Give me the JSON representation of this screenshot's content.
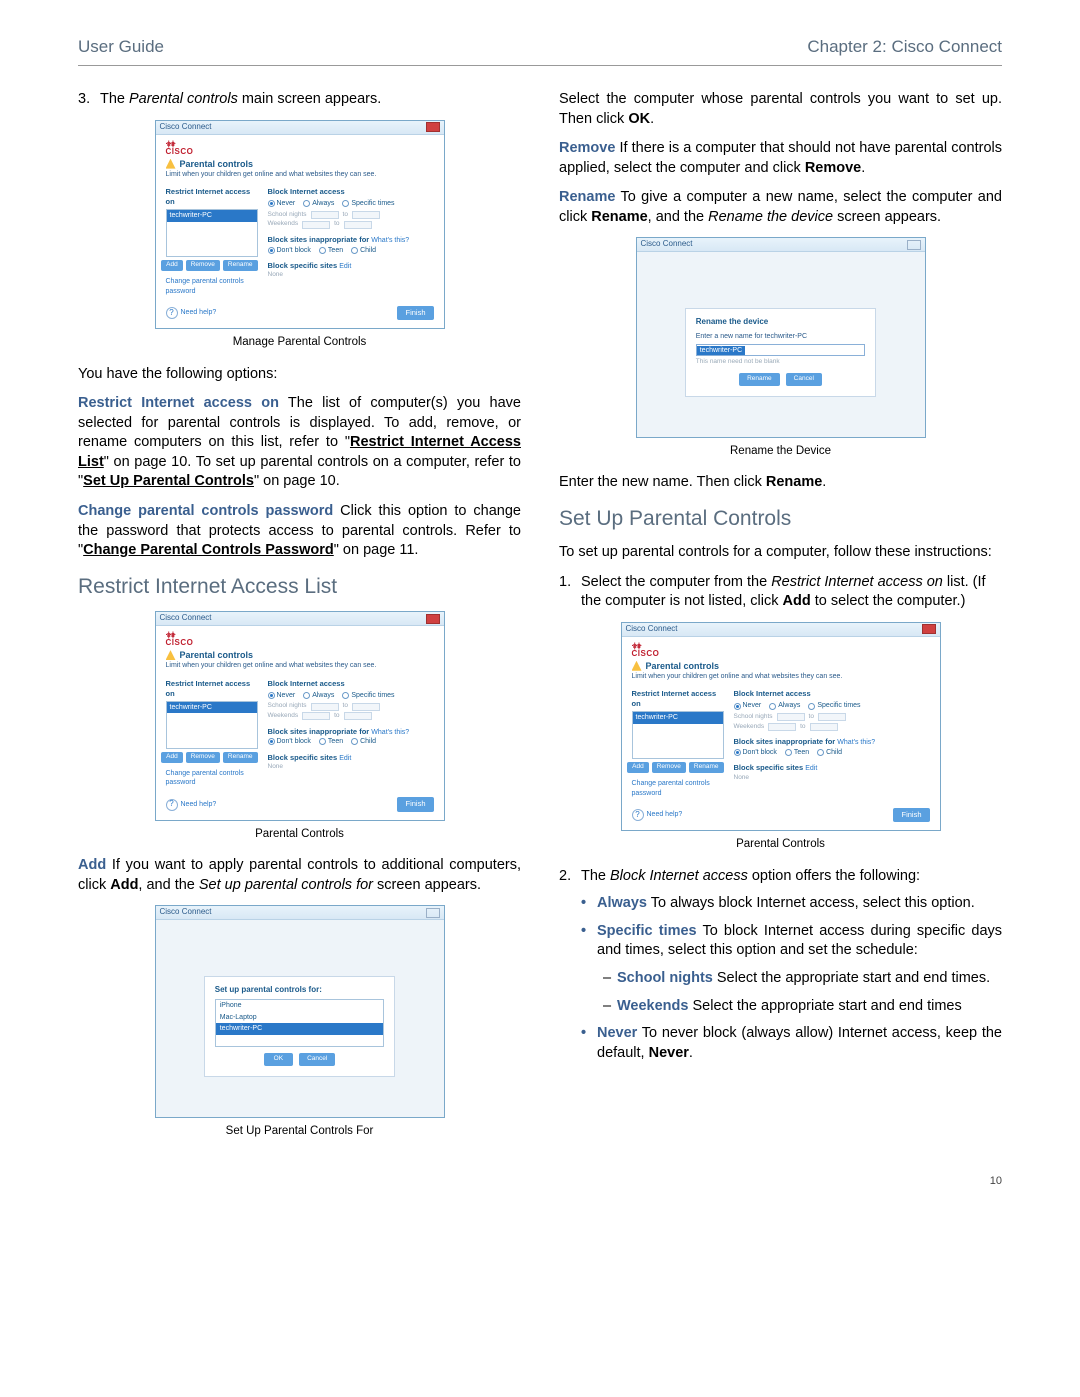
{
  "header": {
    "left": "User Guide",
    "right": "Chapter 2: Cisco Connect"
  },
  "page_number": "10",
  "left_col": {
    "step3": {
      "num": "3.",
      "pre": "The ",
      "ital": "Parental controls",
      "post": " main screen appears."
    },
    "fig1_caption": "Manage Parental Controls",
    "options_intro": "You have the following options:",
    "p_restrict": {
      "lead": "Restrict Internet access on",
      "t1": " The list of computer(s) you have selected for parental controls is displayed. To add, remove, or rename computers on this list, refer to \"",
      "link1": "Restrict Internet Access List",
      "t2": "\" on page 10. To set up parental controls on a computer, refer to \"",
      "link2": "Set Up Parental Controls",
      "t3": "\" on page 10."
    },
    "p_change": {
      "lead": "Change parental controls password",
      "t1": " Click this option to change the password that protects access to parental controls. Refer to \"",
      "link1": "Change Parental Controls Password",
      "t2": "\" on page 11."
    },
    "h_restrict": "Restrict Internet Access List",
    "fig2_caption": "Parental Controls",
    "p_add": {
      "lead": "Add",
      "t1": "  If you want to apply parental controls to additional computers, click ",
      "b1": "Add",
      "t2": ", and the ",
      "ital": "Set up parental controls for",
      "t3": " screen appears."
    },
    "fig3_caption": "Set Up Parental Controls For"
  },
  "right_col": {
    "p_select": {
      "t1": "Select the computer whose parental controls you want to set up. Then click ",
      "b1": "OK",
      "t2": "."
    },
    "p_remove": {
      "lead": "Remove",
      "t1": " If there is a computer that should not have parental controls applied, select the computer and click ",
      "b1": "Remove",
      "t2": "."
    },
    "p_rename": {
      "lead": "Rename",
      "t1": " To give a computer a new name, select the computer and click ",
      "b1": "Rename",
      "t2": ", and the ",
      "ital": "Rename the device",
      "t3": " screen appears."
    },
    "fig4_caption": "Rename the Device",
    "p_enter": {
      "t1": "Enter the new name. Then click ",
      "b1": "Rename",
      "t2": "."
    },
    "h_setup": "Set Up Parental Controls",
    "p_setup_intro": "To set up parental controls for a computer, follow these instructions:",
    "step1": {
      "num": "1.",
      "t1": "Select the computer from the ",
      "ital": "Restrict Internet access on",
      "t2": " list. (If the computer is not listed, click ",
      "b1": "Add",
      "t3": " to select the computer.)"
    },
    "fig5_caption": "Parental Controls",
    "step2": {
      "num": "2.",
      "t1": "The ",
      "ital": "Block Internet access",
      "t2": " option offers the following:"
    },
    "b_always": {
      "lead": "Always",
      "t": " To always block Internet access, select this option."
    },
    "b_specific": {
      "lead": "Specific times",
      "t": " To block Internet access during specific days and times, select this option and set the schedule:"
    },
    "d_school": {
      "lead": "School nights",
      "t": " Select the appropriate start and end times."
    },
    "d_week": {
      "lead": "Weekends",
      "t": " Select the appropriate start and end times"
    },
    "b_never": {
      "lead": "Never",
      "t1": " To never block (always allow) Internet access, keep the default, ",
      "b1": "Never",
      "t2": "."
    }
  },
  "shot_pc": {
    "title": "Cisco Connect",
    "logo_dots": "·ı|ı·ı|ı·",
    "logo_text": "CISCO",
    "heading": "Parental controls",
    "desc": "Limit when your children get online and what websites they can see.",
    "left_label": "Restrict Internet access on",
    "computer": "techwriter-PC",
    "btn_add": "Add",
    "btn_remove": "Remove",
    "btn_rename": "Rename",
    "change_link": "Change parental controls password",
    "right_label": "Block Internet access",
    "r_never": "Never",
    "r_always": "Always",
    "r_specific": "Specific times",
    "sched1": "School nights",
    "sched2": "Weekends",
    "sched_to": "to",
    "inapp_label": "Block sites inappropriate for",
    "inapp_link": "What's this?",
    "r_dont": "Don't block",
    "r_teen": "Teen",
    "r_child": "Child",
    "spec_label": "Block specific sites",
    "spec_edit": "Edit",
    "spec_none": "None",
    "help": "Need help?",
    "finish": "Finish"
  },
  "shot_rename": {
    "title": "Cisco Connect",
    "heading": "Rename the device",
    "sub": "Enter a new name for techwriter-PC",
    "value": "techwriter-PC",
    "note": "This name need not be blank",
    "btn_rename": "Rename",
    "btn_cancel": "Cancel"
  },
  "shot_setup": {
    "title": "Cisco Connect",
    "heading": "Set up parental controls for:",
    "items": [
      "iPhone",
      "Mac-Laptop",
      "techwriter-PC"
    ],
    "btn_ok": "OK",
    "btn_cancel": "Cancel"
  }
}
